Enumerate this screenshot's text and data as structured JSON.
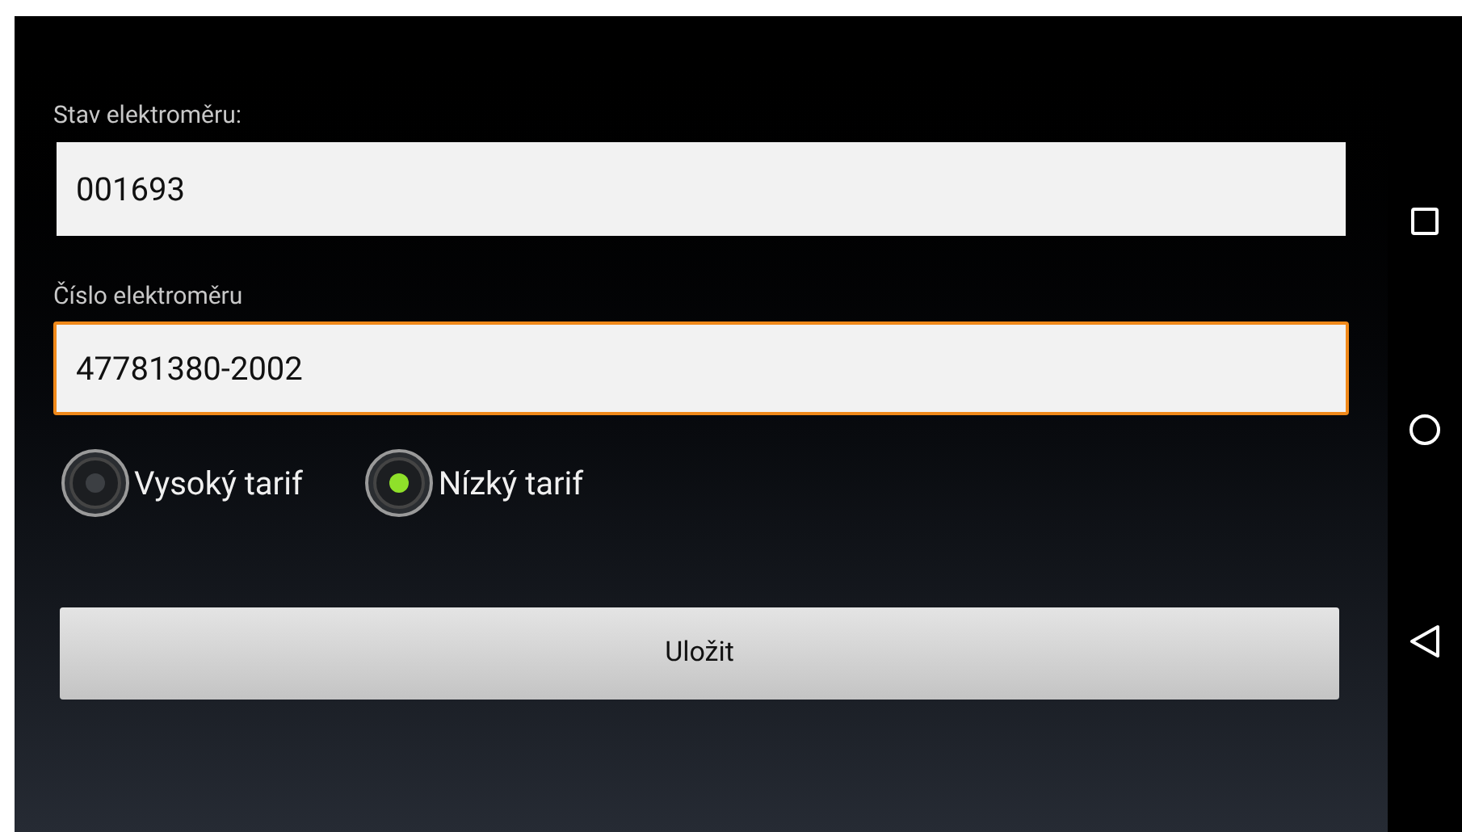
{
  "fields": [
    {
      "label": "Stav elektroměru:",
      "value": "001693",
      "focused": false
    },
    {
      "label": "Číslo elektroměru",
      "value": "47781380-2002",
      "focused": true
    }
  ],
  "tariffs": [
    {
      "label": "Vysoký tarif",
      "selected": false
    },
    {
      "label": "Nízký tarif",
      "selected": true
    }
  ],
  "save_button": {
    "label": "Uložit"
  }
}
